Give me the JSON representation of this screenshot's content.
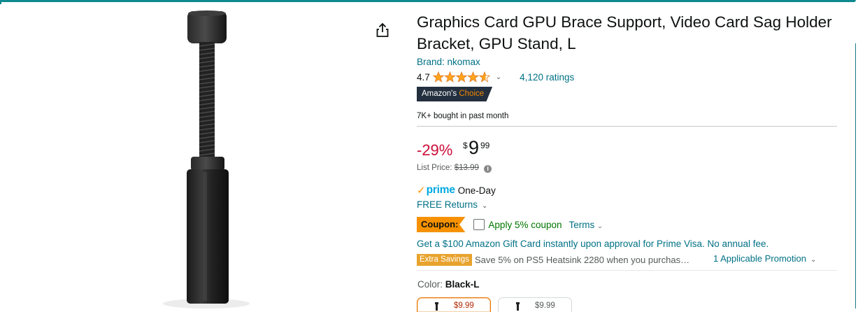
{
  "product": {
    "title": "Graphics Card GPU Brace Support, Video Card Sag Holder Bracket, GPU Stand, L",
    "brand": "Brand: nkomax",
    "rating": "4.7",
    "rating_value": 4.7,
    "ratings_count": "4,120 ratings",
    "choice_label_a": "Amazon's",
    "choice_label_b": "Choice",
    "bought": "7K+ bought in past month"
  },
  "pricing": {
    "discount": "-29%",
    "currency": "$",
    "whole": "9",
    "fraction": "99",
    "list_label": "List Price:",
    "list_value": "$13.99"
  },
  "delivery": {
    "prime_word": "prime",
    "prime_speed": "One-Day",
    "returns": "FREE Returns"
  },
  "coupon": {
    "badge": "Coupon:",
    "apply": "Apply 5% coupon",
    "terms": "Terms"
  },
  "offers": {
    "giftcard": "Get a $100 Amazon Gift Card instantly upon approval for Prime Visa. No annual fee.",
    "extra_badge": "Extra Savings",
    "extra_text": "Save 5% on PS5 Heatsink 2280 when you purchas…",
    "promo": "1 Applicable Promotion"
  },
  "variation": {
    "color_label": "Color:",
    "color_value": "Black-L",
    "options": [
      {
        "price": "$9.99",
        "selected": true
      },
      {
        "price": "$9.99",
        "selected": false
      }
    ]
  },
  "colors": {
    "accent_teal": "#0d8a8f",
    "link": "#007185",
    "discount_red": "#cc0c39",
    "star": "#ffa41c",
    "coupon": "#f79100",
    "choice_bg": "#232f3e"
  }
}
